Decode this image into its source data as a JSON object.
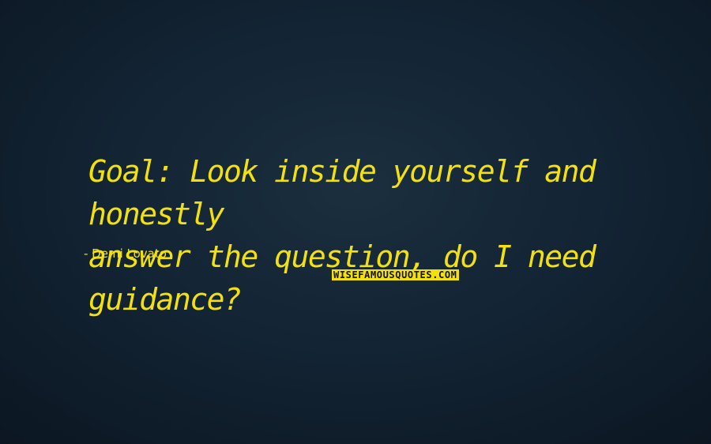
{
  "quote": {
    "text": "Goal: Look inside yourself and honestly\nanswer the question, do I need guidance?",
    "author": "- Demi Lovato"
  },
  "watermark": {
    "text": "WISEFAMOUSQUOTES.COM"
  },
  "colors": {
    "background": "#132434",
    "text": "#f3e10f",
    "watermark_text": "#111111"
  }
}
